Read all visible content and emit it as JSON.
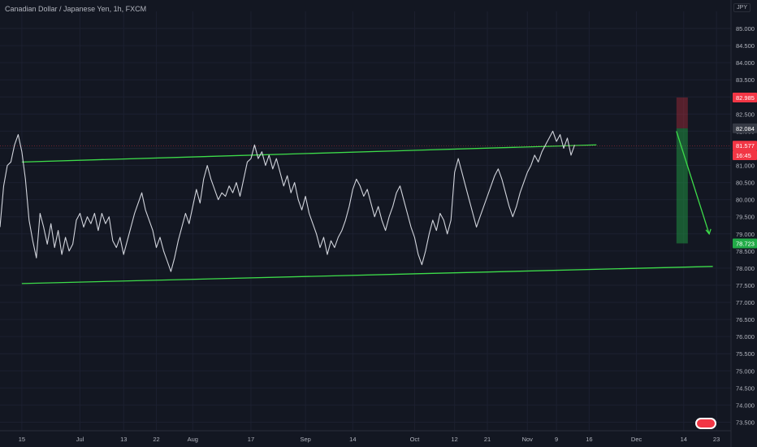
{
  "header": {
    "title": "Canadian Dollar / Japanese Yen, 1h, FXCM"
  },
  "price_axis": {
    "unit": "JPY"
  },
  "chart_data": {
    "type": "line",
    "title": "Canadian Dollar / Japanese Yen, 1h, FXCM",
    "xlabel": "",
    "ylabel": "",
    "ylim": [
      73.25,
      85.5
    ],
    "y_ticks": [
      "85.000",
      "84.500",
      "84.000",
      "83.500",
      "83.000",
      "82.500",
      "82.000",
      "81.500",
      "81.000",
      "80.500",
      "80.000",
      "79.500",
      "79.000",
      "78.500",
      "78.000",
      "77.500",
      "77.000",
      "76.500",
      "76.000",
      "75.500",
      "75.000",
      "74.500",
      "74.000",
      "73.500"
    ],
    "x_tick_labels": [
      {
        "label": "15",
        "t": 0.0
      },
      {
        "label": "Jul",
        "t": 16
      },
      {
        "label": "13",
        "t": 28
      },
      {
        "label": "22",
        "t": 37
      },
      {
        "label": "Aug",
        "t": 47
      },
      {
        "label": "17",
        "t": 63
      },
      {
        "label": "Sep",
        "t": 78
      },
      {
        "label": "14",
        "t": 91
      },
      {
        "label": "Oct",
        "t": 108
      },
      {
        "label": "12",
        "t": 119
      },
      {
        "label": "21",
        "t": 128
      },
      {
        "label": "Nov",
        "t": 139
      },
      {
        "label": "9",
        "t": 147
      },
      {
        "label": "16",
        "t": 156
      },
      {
        "label": "Dec",
        "t": 169
      },
      {
        "label": "14",
        "t": 182
      },
      {
        "label": "23",
        "t": 191
      }
    ],
    "t_range": [
      -6,
      195
    ],
    "series": [
      {
        "color": "#d1d4dc",
        "points": [
          [
            -6,
            79.2
          ],
          [
            -5,
            80.4
          ],
          [
            -4,
            81.0
          ],
          [
            -3,
            81.1
          ],
          [
            -2,
            81.6
          ],
          [
            -1,
            81.9
          ],
          [
            0,
            81.4
          ],
          [
            1,
            80.6
          ],
          [
            2,
            79.4
          ],
          [
            3,
            78.8
          ],
          [
            4,
            78.3
          ],
          [
            5,
            79.6
          ],
          [
            6,
            79.2
          ],
          [
            7,
            78.7
          ],
          [
            8,
            79.3
          ],
          [
            9,
            78.6
          ],
          [
            10,
            79.1
          ],
          [
            11,
            78.4
          ],
          [
            12,
            78.9
          ],
          [
            13,
            78.5
          ],
          [
            14,
            78.7
          ],
          [
            15,
            79.4
          ],
          [
            16,
            79.6
          ],
          [
            17,
            79.2
          ],
          [
            18,
            79.5
          ],
          [
            19,
            79.3
          ],
          [
            20,
            79.6
          ],
          [
            21,
            79.1
          ],
          [
            22,
            79.6
          ],
          [
            23,
            79.3
          ],
          [
            24,
            79.5
          ],
          [
            25,
            78.8
          ],
          [
            26,
            78.6
          ],
          [
            27,
            78.9
          ],
          [
            28,
            78.4
          ],
          [
            29,
            78.8
          ],
          [
            30,
            79.2
          ],
          [
            31,
            79.6
          ],
          [
            32,
            79.9
          ],
          [
            33,
            80.2
          ],
          [
            34,
            79.7
          ],
          [
            35,
            79.4
          ],
          [
            36,
            79.1
          ],
          [
            37,
            78.6
          ],
          [
            38,
            78.9
          ],
          [
            39,
            78.5
          ],
          [
            40,
            78.2
          ],
          [
            41,
            77.9
          ],
          [
            42,
            78.3
          ],
          [
            43,
            78.8
          ],
          [
            44,
            79.2
          ],
          [
            45,
            79.6
          ],
          [
            46,
            79.3
          ],
          [
            47,
            79.8
          ],
          [
            48,
            80.3
          ],
          [
            49,
            79.9
          ],
          [
            50,
            80.6
          ],
          [
            51,
            81.0
          ],
          [
            52,
            80.6
          ],
          [
            53,
            80.3
          ],
          [
            54,
            80.0
          ],
          [
            55,
            80.2
          ],
          [
            56,
            80.1
          ],
          [
            57,
            80.4
          ],
          [
            58,
            80.2
          ],
          [
            59,
            80.5
          ],
          [
            60,
            80.1
          ],
          [
            61,
            80.6
          ],
          [
            62,
            81.1
          ],
          [
            63,
            81.2
          ],
          [
            64,
            81.6
          ],
          [
            65,
            81.2
          ],
          [
            66,
            81.4
          ],
          [
            67,
            81.0
          ],
          [
            68,
            81.3
          ],
          [
            69,
            80.9
          ],
          [
            70,
            81.2
          ],
          [
            71,
            80.8
          ],
          [
            72,
            80.4
          ],
          [
            73,
            80.7
          ],
          [
            74,
            80.2
          ],
          [
            75,
            80.5
          ],
          [
            76,
            80.0
          ],
          [
            77,
            79.7
          ],
          [
            78,
            80.1
          ],
          [
            79,
            79.6
          ],
          [
            80,
            79.3
          ],
          [
            81,
            79.0
          ],
          [
            82,
            78.6
          ],
          [
            83,
            78.9
          ],
          [
            84,
            78.4
          ],
          [
            85,
            78.8
          ],
          [
            86,
            78.6
          ],
          [
            87,
            78.9
          ],
          [
            88,
            79.1
          ],
          [
            89,
            79.4
          ],
          [
            90,
            79.8
          ],
          [
            91,
            80.3
          ],
          [
            92,
            80.6
          ],
          [
            93,
            80.4
          ],
          [
            94,
            80.1
          ],
          [
            95,
            80.3
          ],
          [
            96,
            79.9
          ],
          [
            97,
            79.5
          ],
          [
            98,
            79.8
          ],
          [
            99,
            79.4
          ],
          [
            100,
            79.1
          ],
          [
            101,
            79.5
          ],
          [
            102,
            79.8
          ],
          [
            103,
            80.2
          ],
          [
            104,
            80.4
          ],
          [
            105,
            80.0
          ],
          [
            106,
            79.6
          ],
          [
            107,
            79.2
          ],
          [
            108,
            78.9
          ],
          [
            109,
            78.4
          ],
          [
            110,
            78.1
          ],
          [
            111,
            78.5
          ],
          [
            112,
            79.0
          ],
          [
            113,
            79.4
          ],
          [
            114,
            79.1
          ],
          [
            115,
            79.6
          ],
          [
            116,
            79.4
          ],
          [
            117,
            79.0
          ],
          [
            118,
            79.4
          ],
          [
            119,
            80.8
          ],
          [
            120,
            81.2
          ],
          [
            121,
            80.8
          ],
          [
            122,
            80.4
          ],
          [
            123,
            80.0
          ],
          [
            124,
            79.6
          ],
          [
            125,
            79.2
          ],
          [
            126,
            79.5
          ],
          [
            127,
            79.8
          ],
          [
            128,
            80.1
          ],
          [
            129,
            80.4
          ],
          [
            130,
            80.7
          ],
          [
            131,
            80.9
          ],
          [
            132,
            80.6
          ],
          [
            133,
            80.2
          ],
          [
            134,
            79.8
          ],
          [
            135,
            79.5
          ],
          [
            136,
            79.8
          ],
          [
            137,
            80.2
          ],
          [
            138,
            80.5
          ],
          [
            139,
            80.8
          ],
          [
            140,
            81.0
          ],
          [
            141,
            81.3
          ],
          [
            142,
            81.1
          ],
          [
            143,
            81.4
          ],
          [
            144,
            81.6
          ],
          [
            145,
            81.8
          ],
          [
            146,
            82.0
          ],
          [
            147,
            81.7
          ],
          [
            148,
            81.9
          ],
          [
            149,
            81.5
          ],
          [
            150,
            81.8
          ],
          [
            151,
            81.3
          ],
          [
            152,
            81.6
          ]
        ]
      }
    ],
    "annotations": {
      "channel_upper": [
        [
          0,
          81.1
        ],
        [
          158,
          81.6
        ]
      ],
      "channel_lower": [
        [
          0,
          77.55
        ],
        [
          190,
          78.05
        ]
      ],
      "stop_level": 82.985,
      "entry_level": 82.084,
      "current_price": 81.577,
      "target_level": 78.723,
      "price_labels": [
        "82.985",
        "82.084",
        "81.577",
        "16:45",
        "78.723"
      ]
    }
  }
}
